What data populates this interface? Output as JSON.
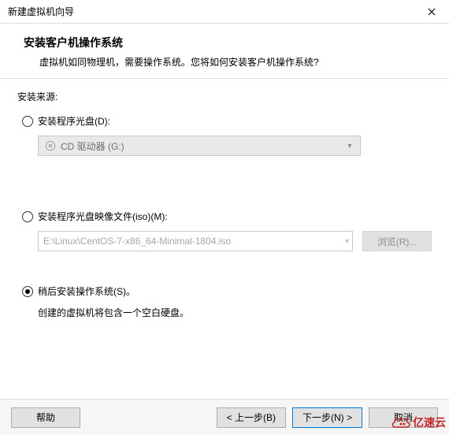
{
  "window": {
    "title": "新建虚拟机向导"
  },
  "header": {
    "heading": "安装客户机操作系统",
    "sub": "虚拟机如同物理机，需要操作系统。您将如何安装客户机操作系统?"
  },
  "source_label": "安装来源:",
  "options": {
    "disc": {
      "label": "安装程序光盘(D):",
      "combo_text": "CD 驱动器 (G:)"
    },
    "iso": {
      "label": "安装程序光盘映像文件(iso)(M):",
      "path": "E:\\Linux\\CentOS-7-x86_64-Minimal-1804.iso",
      "browse": "浏览(R)..."
    },
    "later": {
      "label": "稍后安装操作系统(S)。",
      "note": "创建的虚拟机将包含一个空白硬盘。"
    }
  },
  "footer": {
    "help": "帮助",
    "back": "< 上一步(B)",
    "next": "下一步(N) >",
    "cancel": "取消"
  },
  "watermark": "亿速云"
}
